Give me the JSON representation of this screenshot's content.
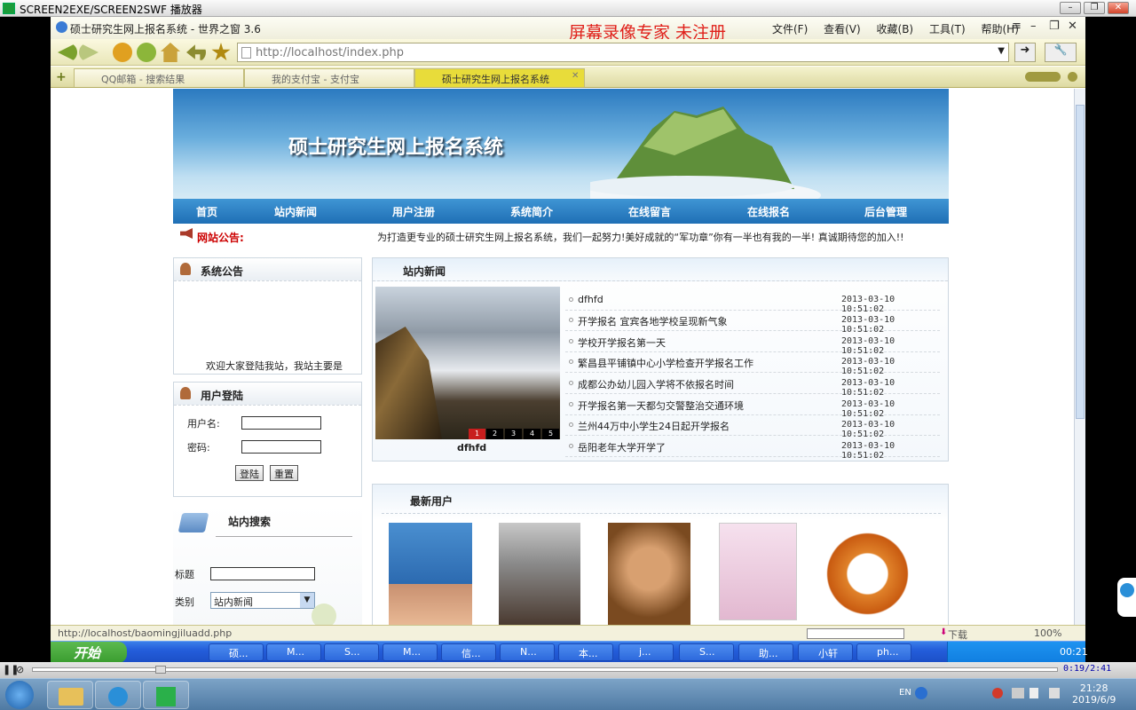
{
  "player": {
    "title": "SCREEN2EXE/SCREEN2SWF 播放器",
    "time": "0:19/2:41"
  },
  "browser": {
    "title": "硕士研究生网上报名系统 - 世界之窗 3.6",
    "watermark": "屏幕录像专家 未注册",
    "menu": [
      "文件(F)",
      "查看(V)",
      "收藏(B)",
      "工具(T)",
      "帮助(H)"
    ],
    "url": "http://localhost/index.php",
    "tabs": [
      "QQ邮箱 - 搜索结果",
      "我的支付宝 - 支付宝",
      "硕士研究生网上报名系统"
    ],
    "status_url": "http://localhost/baomingjiluadd.php",
    "download_label": "下载",
    "zoom": "100%"
  },
  "site": {
    "banner_title": "硕士研究生网上报名系统",
    "nav": [
      "首页",
      "站内新闻",
      "用户注册",
      "系统简介",
      "在线留言",
      "在线报名",
      "后台管理"
    ],
    "notice_label": "网站公告:",
    "notice_text": "为打造更专业的硕士研究生网上报名系统，我们一起努力!美好成就的“军功章”你有一半也有我的一半! 真诚期待您的加入!!",
    "sys_title": "系统公告",
    "sys_text": "欢迎大家登陆我站，我站主要是",
    "login_title": "用户登陆",
    "username_label": "用户名:",
    "password_label": "密码:",
    "login_btn": "登陆",
    "reset_btn": "重置",
    "search_title": "站内搜索",
    "search_title_label": "标题",
    "search_type_label": "类别",
    "search_type_value": "站内新闻",
    "news_title": "站内新闻",
    "news_caption": "dfhfd",
    "news_pages": [
      "1",
      "2",
      "3",
      "4",
      "5"
    ],
    "news": [
      {
        "title": "dfhfd",
        "date": "2013-03-10 10:51:02"
      },
      {
        "title": "开学报名 宜宾各地学校呈现新气象",
        "date": "2013-03-10 10:51:02"
      },
      {
        "title": "学校开学报名第一天",
        "date": "2013-03-10 10:51:02"
      },
      {
        "title": "繁昌县平铺镇中心小学检查开学报名工作",
        "date": "2013-03-10 10:51:02"
      },
      {
        "title": "成都公办幼儿园入学将不依报名时间",
        "date": "2013-03-10 10:51:02"
      },
      {
        "title": "开学报名第一天都匀交警整治交通环境",
        "date": "2013-03-10 10:51:02"
      },
      {
        "title": "兰州44万中小学生24日起开学报名",
        "date": "2013-03-10 10:51:02"
      },
      {
        "title": "岳阳老年大学开学了",
        "date": "2013-03-10 10:51:02"
      }
    ],
    "users_title": "最新用户"
  },
  "xp_taskbar": {
    "start": "开始",
    "items": [
      "硕...",
      "M...",
      "S...",
      "M...",
      "信...",
      "N...",
      "本...",
      "j...",
      "S...",
      "助...",
      "小轩",
      "ph..."
    ],
    "clock": "00:21"
  },
  "w7_taskbar": {
    "lang": "EN",
    "time": "21:28",
    "date": "2019/6/9"
  }
}
